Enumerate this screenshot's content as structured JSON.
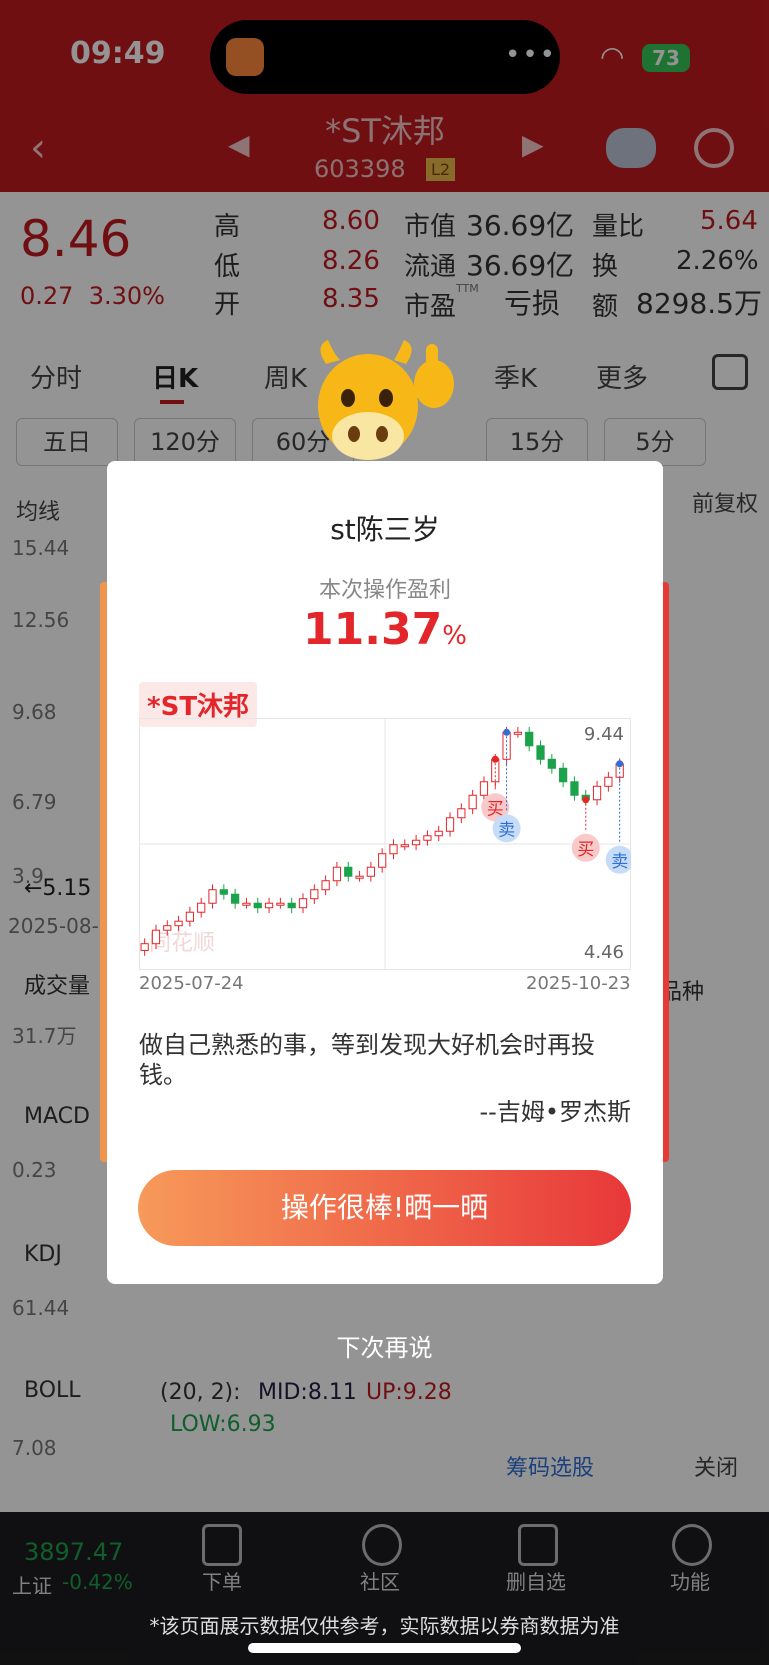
{
  "status": {
    "time": "09:49",
    "battery": "73"
  },
  "header": {
    "stock_name": "*ST沐邦",
    "stock_code": "603398",
    "level": "L2"
  },
  "quote": {
    "price": "8.46",
    "change": "0.27",
    "change_pct": "3.30%",
    "rows": [
      {
        "l1": "高",
        "v1": "8.60",
        "l2": "市值",
        "v2": "36.69亿",
        "l3": "量比",
        "v3": "5.64"
      },
      {
        "l1": "低",
        "v1": "8.26",
        "l2": "流通",
        "v2": "36.69亿",
        "l3": "换",
        "v3": "2.26%"
      },
      {
        "l1": "开",
        "v1": "8.35",
        "l2": "市盈",
        "v2": "亏损",
        "l3": "额",
        "v3": "8298.5万"
      }
    ],
    "pe_sup": "TTM"
  },
  "tabs": [
    "分时",
    "日K",
    "周K",
    "季K",
    "更多"
  ],
  "periods": [
    "五日",
    "120分",
    "60分",
    "15分",
    "5分"
  ],
  "chart_bg": {
    "ma_label": "均线",
    "adj": "前复权",
    "axis": [
      "15.44",
      "12.56",
      "9.68",
      "6.79",
      "3.9"
    ],
    "arrow_val": "←5.15",
    "date": "2025-08-",
    "volume": "成交量",
    "vol_val": "31.7万",
    "macd": "MACD",
    "macd_val": "0.23",
    "kdj": "KDJ",
    "kdj_val": "61.44",
    "boll": "BOLL",
    "boll_params": "(20, 2):",
    "mid": "MID:8.11",
    "up": "UP:9.28",
    "low": "LOW:6.93",
    "boll_axis": "7.08",
    "side": "品种",
    "chip_btn": "筹码选股",
    "close_btn": "关闭"
  },
  "modal": {
    "user": "st陈三岁",
    "profit_label": "本次操作盈利",
    "profit_value": "11.37",
    "profit_unit": "%",
    "tag": "*ST沐邦",
    "price_high": "9.44",
    "price_low": "4.46",
    "date_start": "2025-07-24",
    "date_end": "2025-10-23",
    "buy": "买",
    "sell": "卖",
    "watermark": "同花顺",
    "quote": "做自己熟悉的事，等到发现大好机会时再投钱。",
    "author": "--吉姆•罗杰斯",
    "share_button": "操作很棒!晒一晒",
    "later": "下次再说"
  },
  "nav": {
    "index_value": "3897.47",
    "index_name": "上证",
    "index_change": "-0.42%",
    "items": [
      "下单",
      "社区",
      "删自选",
      "功能"
    ],
    "disclaimer": "*该页面展示数据仅供参考，实际数据以券商数据为准"
  },
  "colors": {
    "up": "#e3262a",
    "down": "#1aa34a",
    "header": "#c21a1f"
  },
  "chart_data": {
    "type": "candlestick",
    "x_start": "2025-07-24",
    "x_end": "2025-10-23",
    "ylim": [
      4.46,
      9.44
    ],
    "close_trend": [
      4.6,
      4.9,
      5.0,
      5.1,
      5.3,
      5.5,
      5.8,
      5.7,
      5.5,
      5.5,
      5.4,
      5.5,
      5.5,
      5.4,
      5.6,
      5.8,
      6.0,
      6.3,
      6.1,
      6.1,
      6.3,
      6.6,
      6.8,
      6.8,
      6.9,
      7.0,
      7.1,
      7.4,
      7.6,
      7.9,
      8.2,
      8.7,
      9.3,
      9.3,
      9.0,
      8.7,
      8.5,
      8.2,
      7.9,
      7.8,
      8.1,
      8.3,
      8.6
    ],
    "markers": [
      {
        "type": "buy",
        "index": 31
      },
      {
        "type": "sell",
        "index": 32
      },
      {
        "type": "buy",
        "index": 39
      },
      {
        "type": "sell",
        "index": 42
      }
    ]
  }
}
